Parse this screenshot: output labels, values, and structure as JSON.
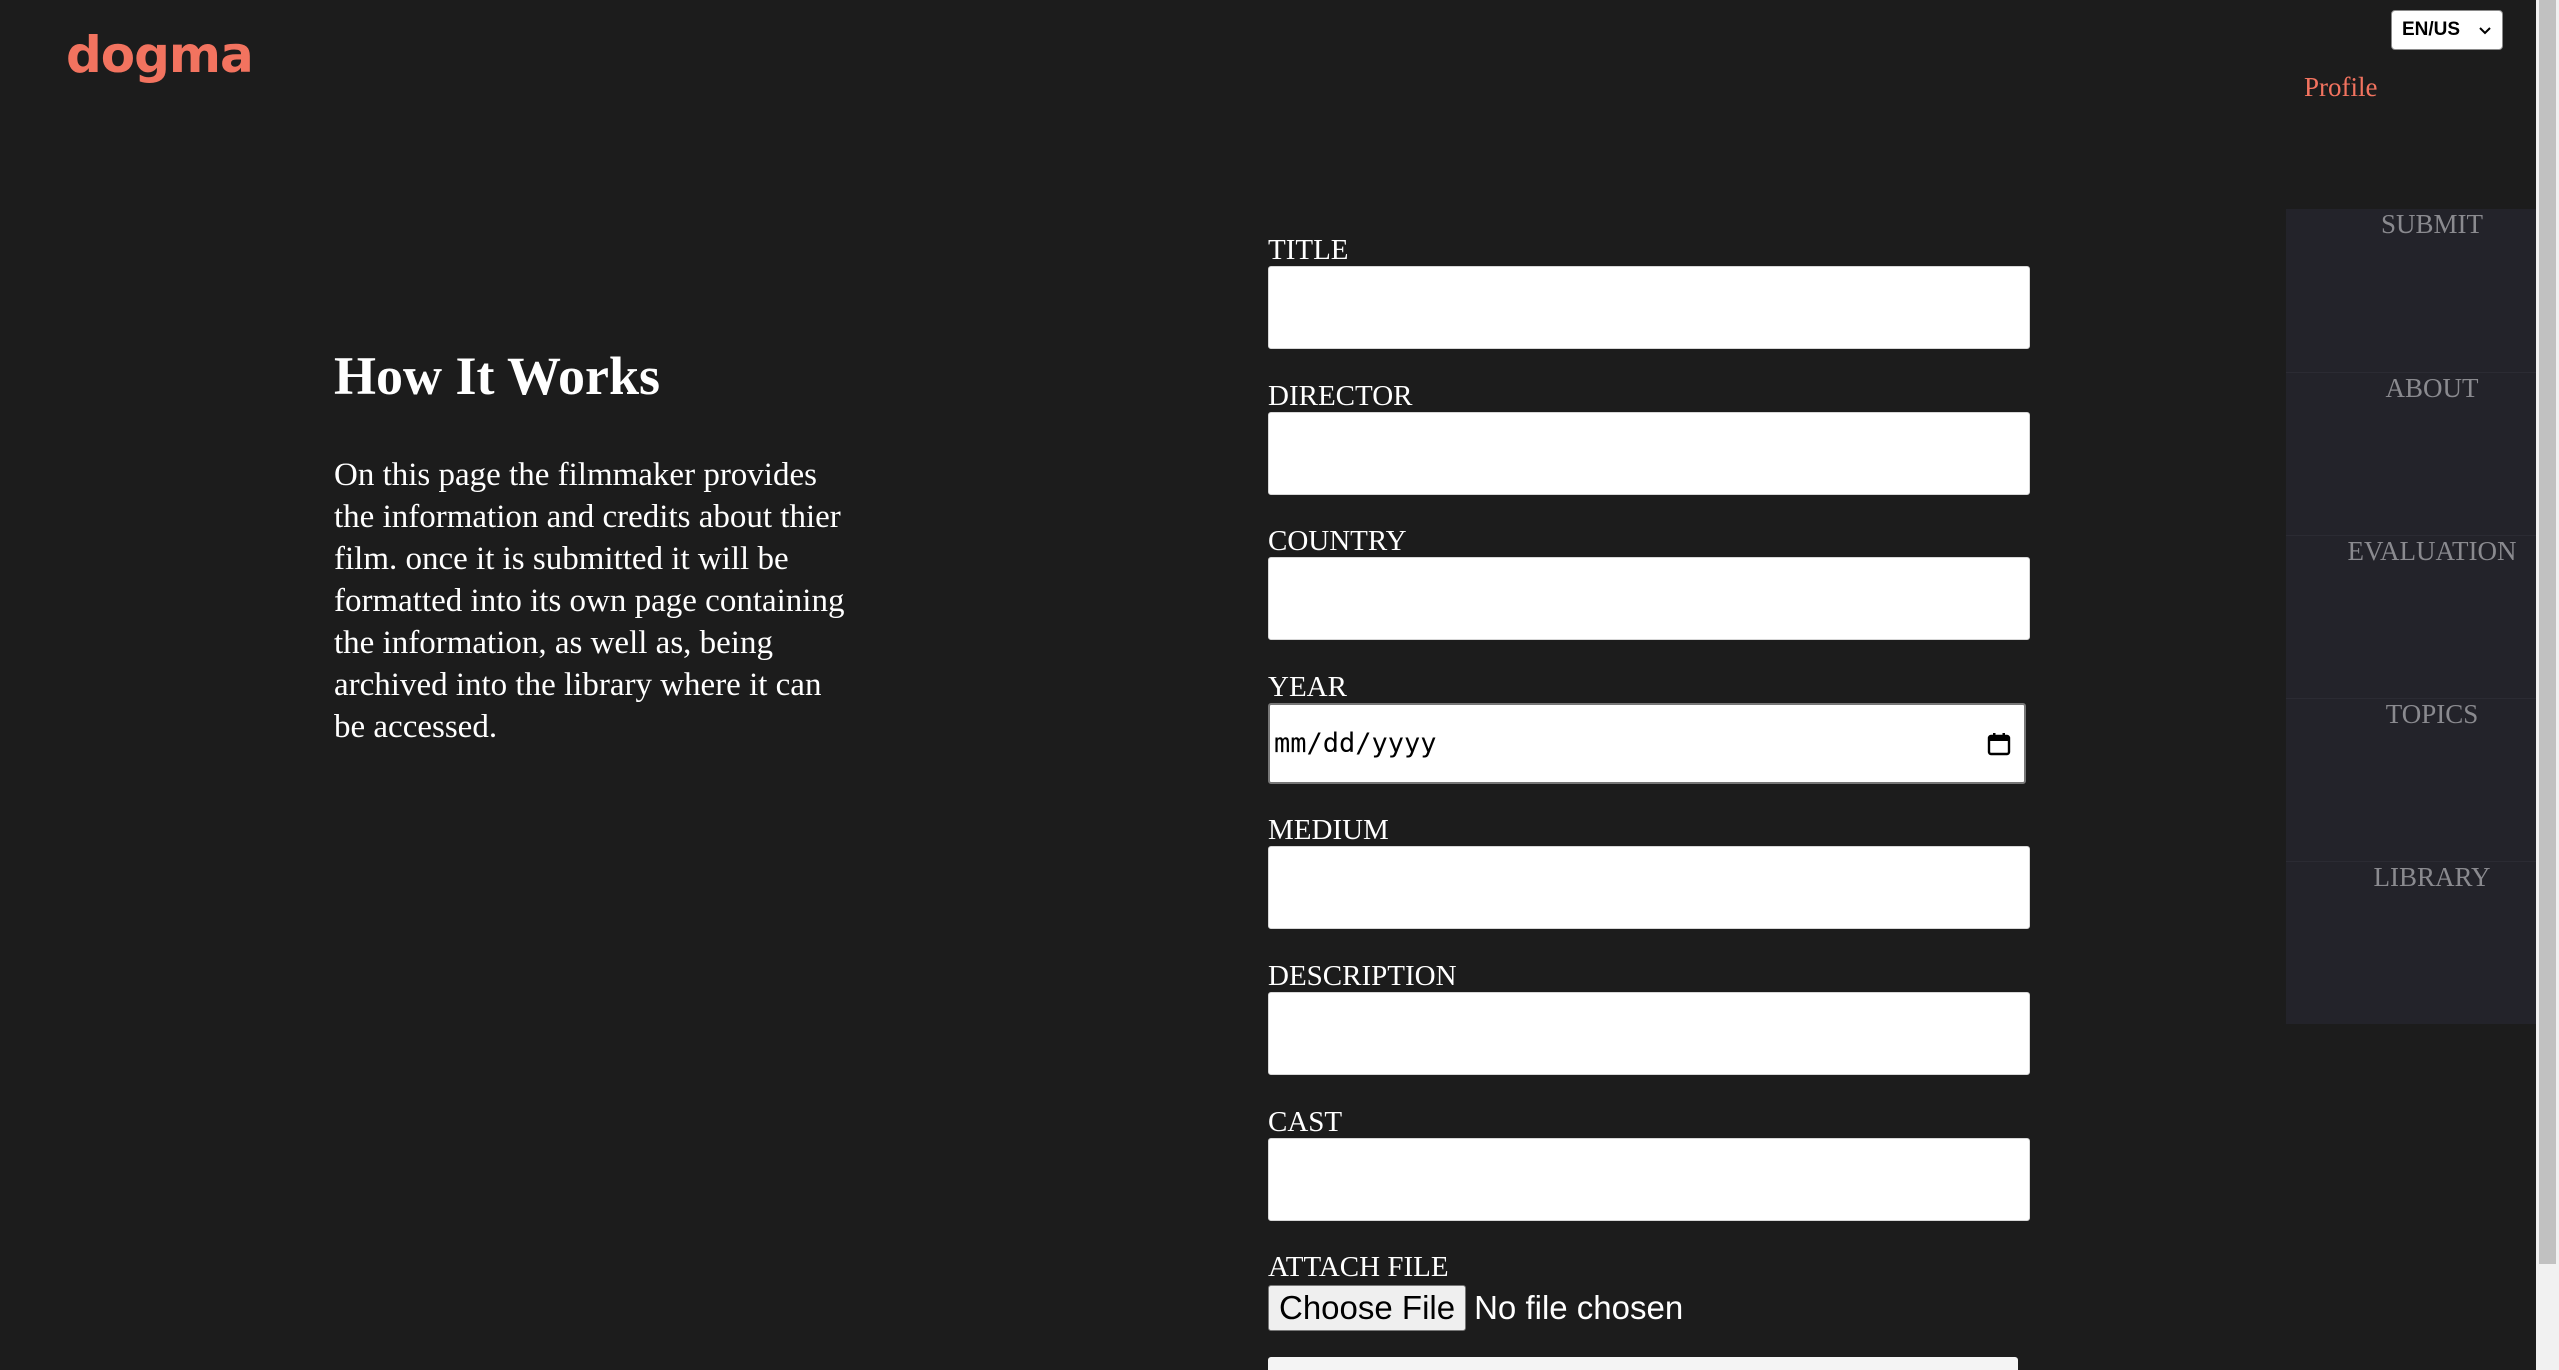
{
  "header": {
    "logo": "dogma",
    "language": "EN/US",
    "profile_label": "Profile"
  },
  "nav": {
    "items": [
      {
        "label": "SUBMIT"
      },
      {
        "label": "ABOUT"
      },
      {
        "label": "EVALUATION"
      },
      {
        "label": "TOPICS"
      },
      {
        "label": "LIBRARY"
      }
    ]
  },
  "info": {
    "title": "How It Works",
    "text": "On this page the filmmaker provides the information and credits about thier film. once it is submitted it will be formatted into its own page containing the information, as well as, being archived into the library where it can be accessed."
  },
  "form": {
    "fields": [
      {
        "label": "TITLE",
        "value": ""
      },
      {
        "label": "DIRECTOR",
        "value": ""
      },
      {
        "label": "COUNTRY",
        "value": ""
      },
      {
        "label": "YEAR",
        "placeholder": "mm/dd/yyyy"
      },
      {
        "label": "MEDIUM",
        "value": ""
      },
      {
        "label": "DESCRIPTION",
        "value": ""
      },
      {
        "label": "CAST",
        "value": ""
      }
    ],
    "attach": {
      "label": "ATTACH FILE",
      "button_label": "Choose File",
      "status": "No file chosen"
    }
  },
  "colors": {
    "background": "#1c1c1c",
    "accent": "#f2735f",
    "nav_panel": "#23232a",
    "nav_text": "#8a8a8f"
  },
  "icons": {
    "language_dropdown": "chevron-down-icon",
    "date_picker": "calendar-icon"
  }
}
